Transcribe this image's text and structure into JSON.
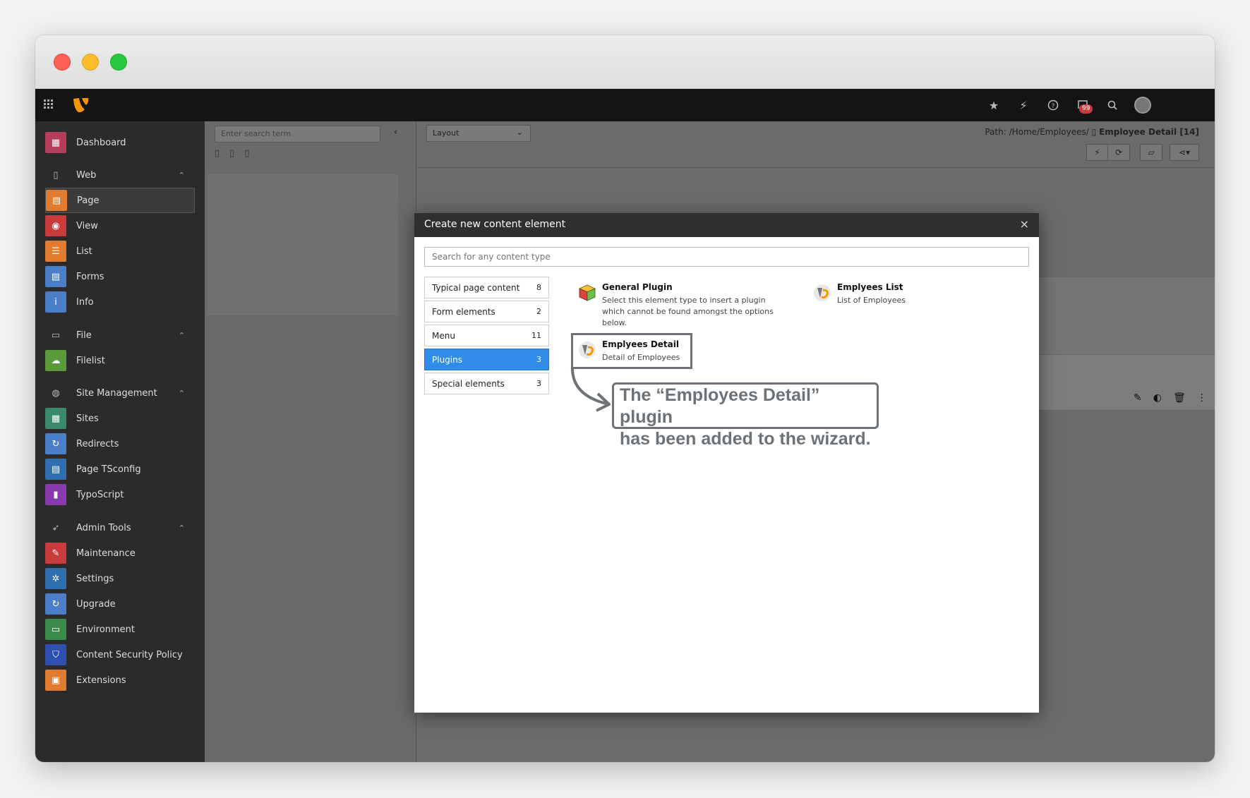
{
  "sidebar": {
    "items": [
      {
        "label": "Dashboard",
        "icon": "dashboard-icon",
        "color": "#b63c5c",
        "type": "item"
      },
      {
        "label": "Web",
        "icon": "page-icon",
        "type": "group"
      },
      {
        "label": "Page",
        "icon": "page-module-icon",
        "color": "#e07b2f",
        "type": "item",
        "active": true
      },
      {
        "label": "View",
        "icon": "eye-icon",
        "color": "#c83c3c",
        "type": "item"
      },
      {
        "label": "List",
        "icon": "list-icon",
        "color": "#e07b2f",
        "type": "item"
      },
      {
        "label": "Forms",
        "icon": "forms-icon",
        "color": "#4a7ec9",
        "type": "item"
      },
      {
        "label": "Info",
        "icon": "info-icon",
        "color": "#4a7ec9",
        "type": "item"
      },
      {
        "label": "File",
        "icon": "image-icon",
        "type": "group"
      },
      {
        "label": "Filelist",
        "icon": "cloud-icon",
        "color": "#5a9a3a",
        "type": "item"
      },
      {
        "label": "Site Management",
        "icon": "globe-icon",
        "type": "group"
      },
      {
        "label": "Sites",
        "icon": "sites-icon",
        "color": "#3a8a6a",
        "type": "item"
      },
      {
        "label": "Redirects",
        "icon": "redirect-icon",
        "color": "#4a7ec9",
        "type": "item"
      },
      {
        "label": "Page TSconfig",
        "icon": "tsconfig-icon",
        "color": "#2f6fb0",
        "type": "item"
      },
      {
        "label": "TypoScript",
        "icon": "typoscript-icon",
        "color": "#8a3ab0",
        "type": "item"
      },
      {
        "label": "Admin Tools",
        "icon": "rocket-icon",
        "type": "group"
      },
      {
        "label": "Maintenance",
        "icon": "wrench-icon",
        "color": "#c83c3c",
        "type": "item"
      },
      {
        "label": "Settings",
        "icon": "gear-icon",
        "color": "#2f6fb0",
        "type": "item"
      },
      {
        "label": "Upgrade",
        "icon": "refresh-icon",
        "color": "#4a7ec9",
        "type": "item"
      },
      {
        "label": "Environment",
        "icon": "monitor-icon",
        "color": "#3a8a4a",
        "type": "item"
      },
      {
        "label": "Content Security Policy",
        "icon": "shield-icon",
        "color": "#2f4fb0",
        "type": "item"
      },
      {
        "label": "Extensions",
        "icon": "box-icon",
        "color": "#e07b2f",
        "type": "item"
      }
    ]
  },
  "topbar": {
    "badge_count": "99"
  },
  "tree": {
    "search_placeholder": "Enter search term"
  },
  "module": {
    "layout_select": "Layout",
    "path_prefix": "Path: /Home/Employees/",
    "page_title": "Employee Detail [14]"
  },
  "modal": {
    "title": "Create new content element",
    "close": "×",
    "search_placeholder": "Search for any content type",
    "categories": [
      {
        "label": "Typical page content",
        "count": "8"
      },
      {
        "label": "Form elements",
        "count": "2"
      },
      {
        "label": "Menu",
        "count": "11"
      },
      {
        "label": "Plugins",
        "count": "3",
        "active": true
      },
      {
        "label": "Special elements",
        "count": "3"
      }
    ],
    "elements": [
      {
        "title": "General Plugin",
        "desc": "Select this element type to insert a plugin which cannot be found amongst the options below."
      },
      {
        "title": "Emplyees List",
        "desc": "List of Employees"
      },
      {
        "title": "Emplyees Detail",
        "desc": "Detail of Employees"
      }
    ],
    "annotation": {
      "line1": "The “Employees Detail” plugin",
      "line2": "has been added to the wizard."
    }
  },
  "colors": {
    "active_blue": "#318ce7",
    "annotation_gray": "#6c7278",
    "topbar": "#141414",
    "sidebar": "#2b2b2b"
  }
}
